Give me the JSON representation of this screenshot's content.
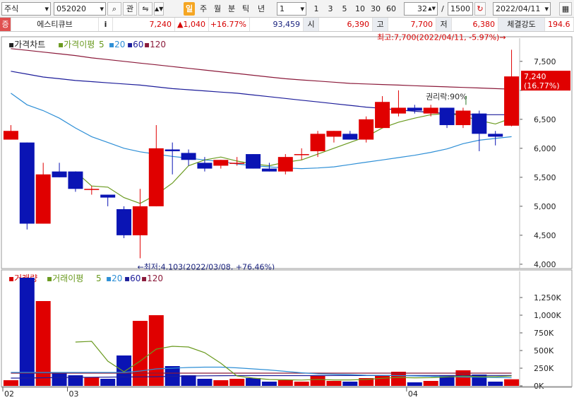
{
  "toolbar": {
    "market_select": "주식",
    "stock_code": "052020",
    "interest_label": "관",
    "period_highlight": "일",
    "periods": [
      "주",
      "월",
      "분",
      "틱",
      "년"
    ],
    "interval_select": "1",
    "intervals": [
      "1",
      "3",
      "5",
      "10",
      "30",
      "60"
    ],
    "count": "32",
    "count_separator": "/",
    "total": "1500",
    "date": "2022/04/11",
    "accent_color": "#f5a623"
  },
  "infobar": {
    "badge": "증",
    "stock_name": "에스티큐브",
    "info_label": "i",
    "price": "7,240",
    "change": "▲1,040",
    "change_pct": "+16.77%",
    "volume": "93,459",
    "open_label": "시",
    "open": "6,390",
    "high_label": "고",
    "high": "7,700",
    "low_label": "저",
    "low": "6,380",
    "strength_label": "체결강도",
    "strength": "194.6"
  },
  "chart_data": [
    {
      "type": "candlestick",
      "legend": [
        "가격차트",
        "가격이평",
        "5",
        "20",
        "60",
        "120"
      ],
      "colors": {
        "up": "#e00000",
        "down": "#0a14b4",
        "ma5": "#6a9a1f",
        "ma20": "#2e8fd6",
        "ma60": "#1d1d9a",
        "ma120": "#8b1a3a"
      },
      "ylim": [
        3950,
        7900
      ],
      "yticks": [
        4000,
        4500,
        5000,
        5500,
        6000,
        6500,
        7000,
        7500
      ],
      "ytick_labels": [
        "4,000",
        "4,500",
        "5,000",
        "5,500",
        "6,000",
        "6,500",
        "",
        "7,500"
      ],
      "x_labels": [
        {
          "index": 0,
          "label": "02"
        },
        {
          "index": 4,
          "label": "03"
        },
        {
          "index": 25,
          "label": "04"
        }
      ],
      "candles": [
        {
          "o": 6150,
          "h": 6400,
          "l": 6150,
          "c": 6300
        },
        {
          "o": 6100,
          "h": 6100,
          "l": 4600,
          "c": 4700
        },
        {
          "o": 4700,
          "h": 5750,
          "l": 4700,
          "c": 5550
        },
        {
          "o": 5600,
          "h": 5750,
          "l": 5500,
          "c": 5500
        },
        {
          "o": 5600,
          "h": 5600,
          "l": 5250,
          "c": 5300
        },
        {
          "o": 5300,
          "h": 5350,
          "l": 5200,
          "c": 5300
        },
        {
          "o": 5200,
          "h": 5200,
          "l": 5000,
          "c": 5150
        },
        {
          "o": 4950,
          "h": 5000,
          "l": 4450,
          "c": 4500
        },
        {
          "o": 4500,
          "h": 5300,
          "l": 4103,
          "c": 5000
        },
        {
          "o": 5000,
          "h": 6400,
          "l": 5000,
          "c": 6000
        },
        {
          "o": 5980,
          "h": 6100,
          "l": 5550,
          "c": 5950
        },
        {
          "o": 5920,
          "h": 5980,
          "l": 5700,
          "c": 5800
        },
        {
          "o": 5750,
          "h": 5850,
          "l": 5600,
          "c": 5650
        },
        {
          "o": 5700,
          "h": 5800,
          "l": 5650,
          "c": 5800
        },
        {
          "o": 5750,
          "h": 5850,
          "l": 5700,
          "c": 5750
        },
        {
          "o": 5900,
          "h": 5900,
          "l": 5650,
          "c": 5650
        },
        {
          "o": 5650,
          "h": 5750,
          "l": 5600,
          "c": 5600
        },
        {
          "o": 5600,
          "h": 5900,
          "l": 5550,
          "c": 5850
        },
        {
          "o": 5900,
          "h": 6000,
          "l": 5800,
          "c": 5900
        },
        {
          "o": 5950,
          "h": 6300,
          "l": 5850,
          "c": 6250
        },
        {
          "o": 6200,
          "h": 6300,
          "l": 6100,
          "c": 6300
        },
        {
          "o": 6250,
          "h": 6300,
          "l": 6150,
          "c": 6150
        },
        {
          "o": 6150,
          "h": 6550,
          "l": 6100,
          "c": 6500
        },
        {
          "o": 6350,
          "h": 6900,
          "l": 6350,
          "c": 6800
        },
        {
          "o": 6600,
          "h": 7000,
          "l": 6550,
          "c": 6700
        },
        {
          "o": 6700,
          "h": 6750,
          "l": 6600,
          "c": 6650
        },
        {
          "o": 6600,
          "h": 6750,
          "l": 6550,
          "c": 6700
        },
        {
          "o": 6700,
          "h": 6700,
          "l": 6350,
          "c": 6400
        },
        {
          "o": 6400,
          "h": 6700,
          "l": 6350,
          "c": 6650
        },
        {
          "o": 6600,
          "h": 6650,
          "l": 5950,
          "c": 6250
        },
        {
          "o": 6250,
          "h": 6300,
          "l": 6050,
          "c": 6200
        },
        {
          "o": 6390,
          "h": 7700,
          "l": 6380,
          "c": 7240
        }
      ],
      "ma5": [
        null,
        null,
        null,
        null,
        5600,
        5350,
        5330,
        5150,
        5050,
        5200,
        5400,
        5700,
        5800,
        5850,
        5780,
        5730,
        5700,
        5760,
        5800,
        5900,
        6000,
        6100,
        6200,
        6350,
        6450,
        6520,
        6580,
        6600,
        6560,
        6480,
        6420,
        6520
      ],
      "ma20": [
        6950,
        6750,
        6650,
        6520,
        6350,
        6200,
        6100,
        6000,
        5940,
        5900,
        5860,
        5830,
        5800,
        5770,
        5730,
        5700,
        5680,
        5660,
        5650,
        5660,
        5680,
        5720,
        5760,
        5800,
        5840,
        5880,
        5930,
        5990,
        6080,
        6140,
        6170,
        6200
      ],
      "ma60": [
        7330,
        7280,
        7230,
        7200,
        7170,
        7150,
        7130,
        7110,
        7090,
        7060,
        7030,
        7010,
        6990,
        6970,
        6950,
        6920,
        6890,
        6860,
        6830,
        6800,
        6770,
        6740,
        6710,
        6690,
        6660,
        6640,
        6620,
        6600,
        6590,
        6580,
        6580,
        6580
      ],
      "ma120": [
        7720,
        7690,
        7660,
        7630,
        7600,
        7560,
        7530,
        7500,
        7470,
        7440,
        7410,
        7380,
        7350,
        7320,
        7290,
        7260,
        7230,
        7200,
        7180,
        7160,
        7140,
        7120,
        7110,
        7100,
        7090,
        7080,
        7070,
        7060,
        7050,
        7040,
        7030,
        7020
      ],
      "annotations": {
        "high": "최고:7,700(2022/04/11, -5.97%)",
        "low": "←최저:4,103(2022/03/08, +76.46%)",
        "ex_rights": "권리락:90%",
        "current_price": "7,240",
        "current_pct": "(16.77%)"
      }
    },
    {
      "type": "bar",
      "legend": [
        "거래량",
        "거래이평",
        "5",
        "20",
        "60",
        "120"
      ],
      "colors": {
        "ma5": "#6a9a1f",
        "ma20": "#2e8fd6",
        "ma60": "#1d1d9a",
        "ma120": "#8b1a3a"
      },
      "ylim": [
        0,
        1550000
      ],
      "yticks": [
        0,
        250000,
        500000,
        750000,
        1000000,
        1250000
      ],
      "ytick_labels": [
        "0K",
        "250K",
        "500K",
        "750K",
        "1,000K",
        "1,250K"
      ],
      "values": [
        80000,
        1530000,
        1200000,
        180000,
        150000,
        120000,
        100000,
        430000,
        920000,
        1000000,
        280000,
        150000,
        100000,
        80000,
        100000,
        110000,
        60000,
        80000,
        60000,
        150000,
        70000,
        60000,
        110000,
        150000,
        200000,
        50000,
        70000,
        150000,
        220000,
        160000,
        60000,
        93459
      ],
      "ma5": [
        null,
        null,
        null,
        null,
        620000,
        630000,
        350000,
        200000,
        350000,
        520000,
        560000,
        550000,
        470000,
        320000,
        140000,
        110000,
        90000,
        86000,
        82000,
        92000,
        84000,
        84000,
        90000,
        108000,
        118000,
        114000,
        116000,
        126000,
        138000,
        130000,
        130000,
        140000
      ],
      "ma20": [
        190000,
        190000,
        190000,
        190000,
        190000,
        190000,
        190000,
        190000,
        210000,
        240000,
        250000,
        260000,
        265000,
        265000,
        255000,
        240000,
        225000,
        205000,
        185000,
        170000,
        165000,
        160000,
        150000,
        148000,
        145000,
        140000,
        135000,
        130000,
        125000,
        122000,
        118000,
        115000
      ],
      "ma60": [
        110000,
        110000,
        115000,
        118000,
        120000,
        122000,
        124000,
        126000,
        128000,
        130000,
        135000,
        140000,
        142000,
        144000,
        145000,
        145000,
        145000,
        145000,
        145000,
        145000,
        146000,
        146000,
        146000,
        146000,
        147000,
        147000,
        147000,
        147000,
        147000,
        147000,
        147000,
        147000
      ],
      "ma120": [
        180000,
        180000,
        180000,
        180000,
        180000,
        180000,
        180000,
        180000,
        180000,
        180000,
        180000,
        180000,
        180000,
        180000,
        180000,
        180000,
        180000,
        180000,
        180000,
        180000,
        180000,
        180000,
        180000,
        180000,
        180000,
        180000,
        180000,
        180000,
        180000,
        180000,
        180000,
        180000
      ]
    }
  ]
}
